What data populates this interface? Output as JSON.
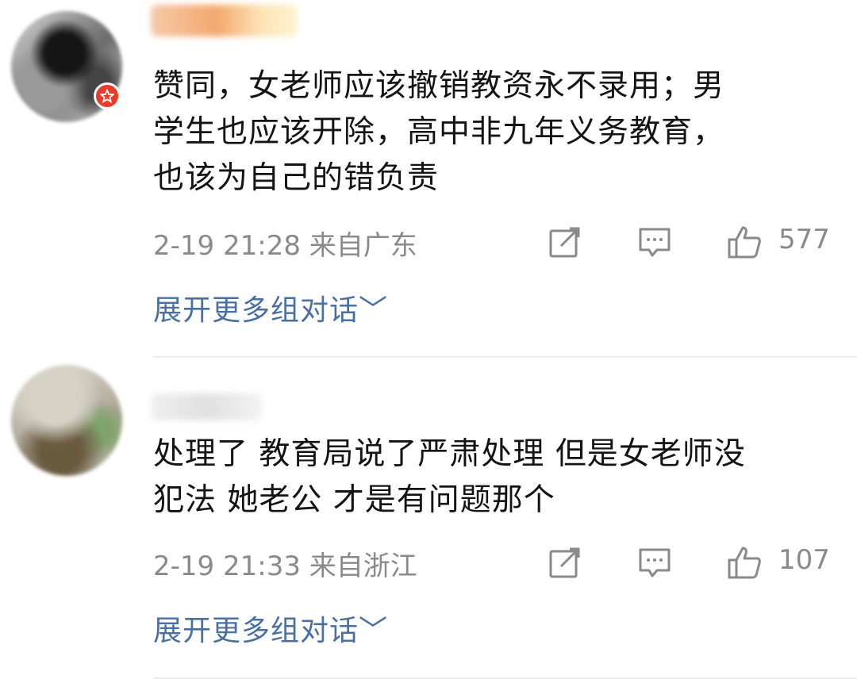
{
  "comments": [
    {
      "text_lines": [
        "赞同，女老师应该撤销教资永不录用；男",
        "学生也应该开除，高中非九年义务教育，",
        "也该为自己的错负责"
      ],
      "time": "2-19 21:28",
      "location": "来自广东",
      "likes": "577",
      "expand_label": "展开更多组对话",
      "verified_badge_color": "#ec3a2a",
      "icons": [
        "share-icon",
        "comment-icon",
        "like-icon",
        "chevron-down-icon"
      ]
    },
    {
      "text_lines": [
        "处理了 教育局说了严肃处理 但是女老师没",
        "犯法 她老公 才是有问题那个"
      ],
      "time": "2-19 21:33",
      "location": "来自浙江",
      "likes": "107",
      "expand_label": "展开更多组对话",
      "icons": [
        "share-icon",
        "comment-icon",
        "like-icon",
        "chevron-down-icon"
      ]
    }
  ],
  "colors": {
    "link": "#4a6fa3",
    "meta": "#8a8a8a",
    "text": "#141414"
  }
}
